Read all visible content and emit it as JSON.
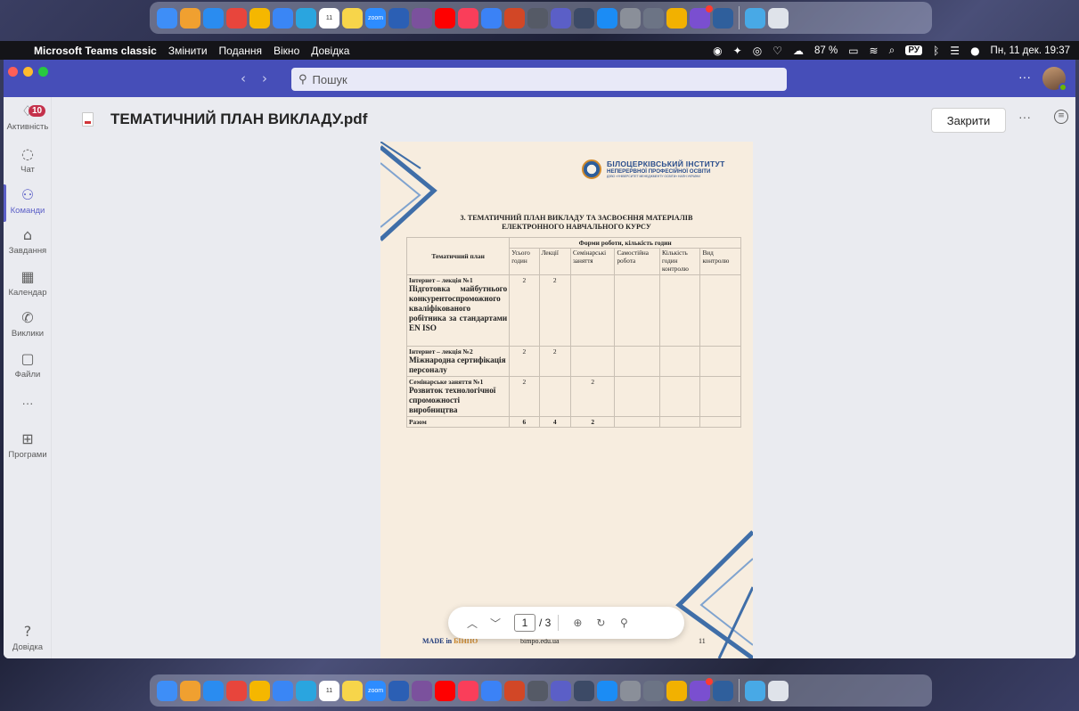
{
  "dock": {
    "apps": [
      {
        "icon": "finder-icon",
        "color": "#3e8ef7"
      },
      {
        "icon": "launchpad-icon",
        "color": "#f0a030"
      },
      {
        "icon": "safari-icon",
        "color": "#2a8cf0"
      },
      {
        "icon": "chrome-icon",
        "color": "#e8453c"
      },
      {
        "icon": "photos-icon",
        "color": "#f5b700"
      },
      {
        "icon": "mail-icon",
        "color": "#3a86f5"
      },
      {
        "icon": "telegram-icon",
        "color": "#2aa5df"
      },
      {
        "icon": "calendar-icon",
        "color": "#ffffff",
        "label": "11"
      },
      {
        "icon": "notes-icon",
        "color": "#f7d54a"
      },
      {
        "icon": "zoom-icon",
        "color": "#2d8cff",
        "label": "zoom"
      },
      {
        "icon": "word-icon",
        "color": "#2b5fb4"
      },
      {
        "icon": "viber-icon",
        "color": "#7b519d"
      },
      {
        "icon": "youtube-icon",
        "color": "#ff0000"
      },
      {
        "icon": "music-icon",
        "color": "#fa3e5a"
      },
      {
        "icon": "chatgpt-icon",
        "color": "#3b82f6"
      },
      {
        "icon": "powerpoint-icon",
        "color": "#d24726"
      },
      {
        "icon": "calculator-icon",
        "color": "#555a66"
      },
      {
        "icon": "teams-icon",
        "color": "#5b5fc7"
      },
      {
        "icon": "settings-icon",
        "color": "#3c4a66"
      },
      {
        "icon": "appstore-icon",
        "color": "#1b8cf5"
      },
      {
        "icon": "system-prefs-icon",
        "color": "#8a8f99"
      },
      {
        "icon": "preview-icon",
        "color": "#6c7485"
      },
      {
        "icon": "photobooth-icon",
        "color": "#f2b100"
      },
      {
        "icon": "viber2-icon",
        "color": "#7a4fd0",
        "badge": true
      },
      {
        "icon": "remote-desktop-icon",
        "color": "#2f5f9c"
      }
    ],
    "trailing": [
      {
        "icon": "downloads-folder-icon",
        "color": "#48a9e6"
      },
      {
        "icon": "trash-icon",
        "color": "#dfe3ea"
      }
    ]
  },
  "menubar": {
    "app": "Microsoft Teams classic",
    "items": [
      "Змінити",
      "Подання",
      "Вікно",
      "Довідка"
    ],
    "battery": "87 %",
    "keyboard": "РУ",
    "datetime": "Пн, 11 дек. 19:37"
  },
  "titlebar": {
    "search_placeholder": "Пошук",
    "more": "···"
  },
  "rail": {
    "activity_badge": "10",
    "items": {
      "activity": "Активність",
      "chat": "Чат",
      "teams": "Команди",
      "tasks": "Завдання",
      "calendar": "Календар",
      "calls": "Виклики",
      "files": "Файли",
      "more": "···",
      "apps": "Програми",
      "help": "Довідка"
    }
  },
  "header": {
    "title": "ТЕМАТИЧНИЙ ПЛАН ВИКЛАДУ.pdf",
    "close": "Закрити",
    "more": "···"
  },
  "document": {
    "logo": {
      "line1": "БІЛОЦЕРКІВСЬКИЙ ІНСТИТУТ",
      "line2": "НЕПЕРЕРВНОЇ ПРОФЕСІЙНОЇ ОСВІТИ",
      "line3": "ДЗВО «УНІВЕРСИТЕТ МЕНЕДЖМЕНТУ ОСВІТИ» НАПН УКРАЇНИ"
    },
    "section_title_1": "3. ТЕМАТИЧНИЙ ПЛАН ВИКЛАДУ ТА ЗАСВОЄННЯ МАТЕРІАЛІВ",
    "section_title_2": "ЕЛЕКТРОННОГО НАВЧАЛЬНОГО КУРСУ",
    "table": {
      "col_plan": "Тематичний план",
      "group_header": "Форми роботи, кількість годин",
      "cols": [
        "Усього годин",
        "Лекції",
        "Семінарські заняття",
        "Самостійна робота",
        "Кількість годин контролю",
        "Вид контролю"
      ],
      "rows": [
        {
          "kind": "Інтернет – лекція №1",
          "topic": "Підготовка майбутнього конкурентоспроможного кваліфікованого робітника за стандартами EN ISO",
          "vals": [
            "2",
            "2",
            "",
            "",
            "",
            ""
          ]
        },
        {
          "kind": "Інтернет – лекція №2",
          "topic": "Міжнародна сертифікація персоналу",
          "vals": [
            "2",
            "2",
            "",
            "",
            "",
            ""
          ]
        },
        {
          "kind": "Семінарське заняття №1",
          "topic": "Розвиток технологічної спроможності виробництва",
          "vals": [
            "2",
            "",
            "2",
            "",
            "",
            ""
          ]
        }
      ],
      "total": {
        "label": "Разом",
        "vals": [
          "6",
          "4",
          "2",
          "",
          "",
          ""
        ]
      }
    },
    "footer": {
      "made_in": "MADE in",
      "made_brand": "БІНПО",
      "url": "bimpo.edu.ua",
      "page_num": "11"
    }
  },
  "pdf_toolbar": {
    "page": "1",
    "total": "/ 3"
  }
}
